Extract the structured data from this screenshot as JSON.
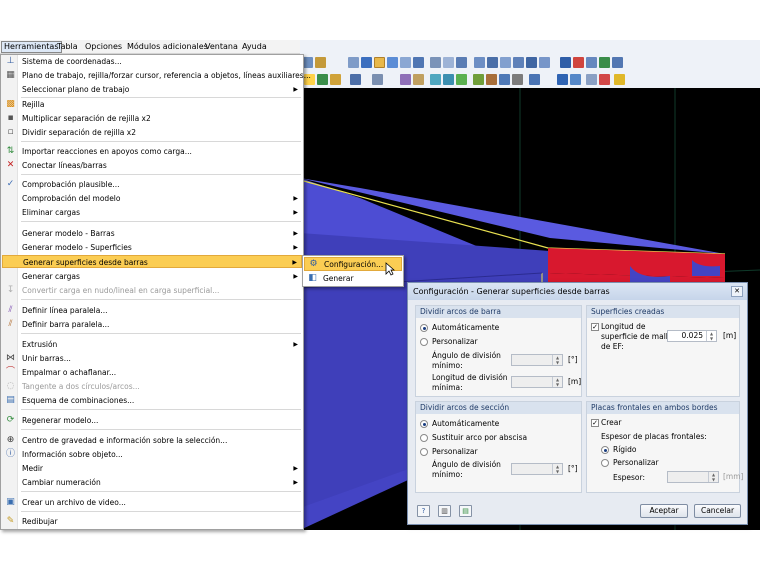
{
  "menubar": {
    "items": [
      {
        "label": "Herramientas",
        "active": true
      },
      {
        "label": "Tabla"
      },
      {
        "label": "Opciones"
      },
      {
        "label": "Módulos adicionales"
      },
      {
        "label": "Ventana"
      },
      {
        "label": "Ayuda"
      }
    ]
  },
  "dropdown": {
    "items": [
      {
        "label": "Sistema de coordenadas...",
        "icon": "coordinate-system-icon"
      },
      {
        "label": "Plano de trabajo, rejilla/forzar cursor, referencia a objetos, líneas auxiliares...",
        "icon": "work-plane-icon"
      },
      {
        "label": "Seleccionar plano de trabajo",
        "submenu": true
      },
      {
        "label": "Rejilla",
        "icon": "grid-icon"
      },
      {
        "label": "Multiplicar separación de rejilla x2",
        "icon": "grid-multiply-icon"
      },
      {
        "label": "Dividir separación de rejilla x2",
        "icon": "grid-divide-icon"
      },
      {
        "label": "Importar reacciones en apoyos como carga...",
        "icon": "import-reactions-icon"
      },
      {
        "label": "Conectar líneas/barras",
        "icon": "connect-lines-icon"
      },
      {
        "label": "Comprobación plausible...",
        "icon": "plausibility-check-icon"
      },
      {
        "label": "Comprobación del modelo",
        "submenu": true
      },
      {
        "label": "Eliminar cargas",
        "submenu": true
      },
      {
        "label": "Generar modelo - Barras",
        "submenu": true
      },
      {
        "label": "Generar modelo - Superficies",
        "submenu": true
      },
      {
        "label": "Generar superficies desde barras",
        "submenu": true,
        "selected": true
      },
      {
        "label": "Generar cargas",
        "submenu": true
      },
      {
        "label": "Convertir carga en nudo/lineal en carga superficial...",
        "disabled": true
      },
      {
        "label": "Definir línea paralela...",
        "icon": "parallel-line-icon"
      },
      {
        "label": "Definir barra paralela...",
        "icon": "parallel-member-icon"
      },
      {
        "label": "Extrusión",
        "submenu": true
      },
      {
        "label": "Unir barras...",
        "icon": "join-members-icon"
      },
      {
        "label": "Empalmar o achaflanar...",
        "icon": "fillet-chamfer-icon"
      },
      {
        "label": "Tangente a dos círculos/arcos...",
        "icon": "tangent-icon",
        "disabled": true
      },
      {
        "label": "Esquema de combinaciones...",
        "icon": "combination-scheme-icon"
      },
      {
        "label": "Regenerar modelo...",
        "icon": "regenerate-model-icon"
      },
      {
        "label": "Centro de gravedad e información sobre la selección...",
        "icon": "center-of-gravity-icon"
      },
      {
        "label": "Información sobre objeto...",
        "icon": "object-info-icon"
      },
      {
        "label": "Medir",
        "submenu": true
      },
      {
        "label": "Cambiar numeración",
        "submenu": true
      },
      {
        "label": "Crear un archivo de video...",
        "icon": "video-file-icon"
      },
      {
        "label": "Redibujar",
        "icon": "redraw-icon"
      }
    ]
  },
  "submenu": {
    "items": [
      {
        "label": "Configuración...",
        "icon": "settings-icon",
        "selected": true
      },
      {
        "label": "Generar",
        "icon": "generate-icon"
      }
    ]
  },
  "dialog": {
    "title": "Configuración - Generar superficies desde barras",
    "close": "✕",
    "bar_arcs": {
      "header": "Dividir arcos de barra",
      "automatic": "Automáticamente",
      "custom": "Personalizar",
      "min_angle_label": "Ángulo de división mínimo:",
      "min_angle_unit": "[°]",
      "min_length_label": "Longitud de división mínima:",
      "min_length_unit": "[m]"
    },
    "created_surfaces": {
      "header": "Superficies creadas",
      "fe_length_label": "Longitud de superficie de malla de EF:",
      "fe_length_value": "0.025",
      "fe_length_unit": "[m]"
    },
    "section_arcs": {
      "header": "Dividir arcos de sección",
      "automatic": "Automáticamente",
      "replace": "Sustituir arco por abscisa",
      "custom": "Personalizar",
      "min_angle_label": "Ángulo de división mínimo:",
      "min_angle_unit": "[°]"
    },
    "end_plates": {
      "header": "Placas frontales en ambos bordes",
      "create": "Crear",
      "thickness_label": "Espesor de placas frontales:",
      "rigid": "Rígido",
      "custom": "Personalizar",
      "thickness_field_label": "Espesor:",
      "thickness_unit": "[mm]"
    },
    "buttons": {
      "accept": "Aceptar",
      "cancel": "Cancelar",
      "help_icon": "help-icon",
      "defaults_icon": "defaults-icon",
      "save_icon": "save-defaults-icon"
    }
  },
  "colors": {
    "menu_highlight": "#fbcd53",
    "viewport_bg": "#000000",
    "member_top": "#4a4acc",
    "member_end": "#d8182e",
    "dialog_bg": "#e7ebf2"
  }
}
